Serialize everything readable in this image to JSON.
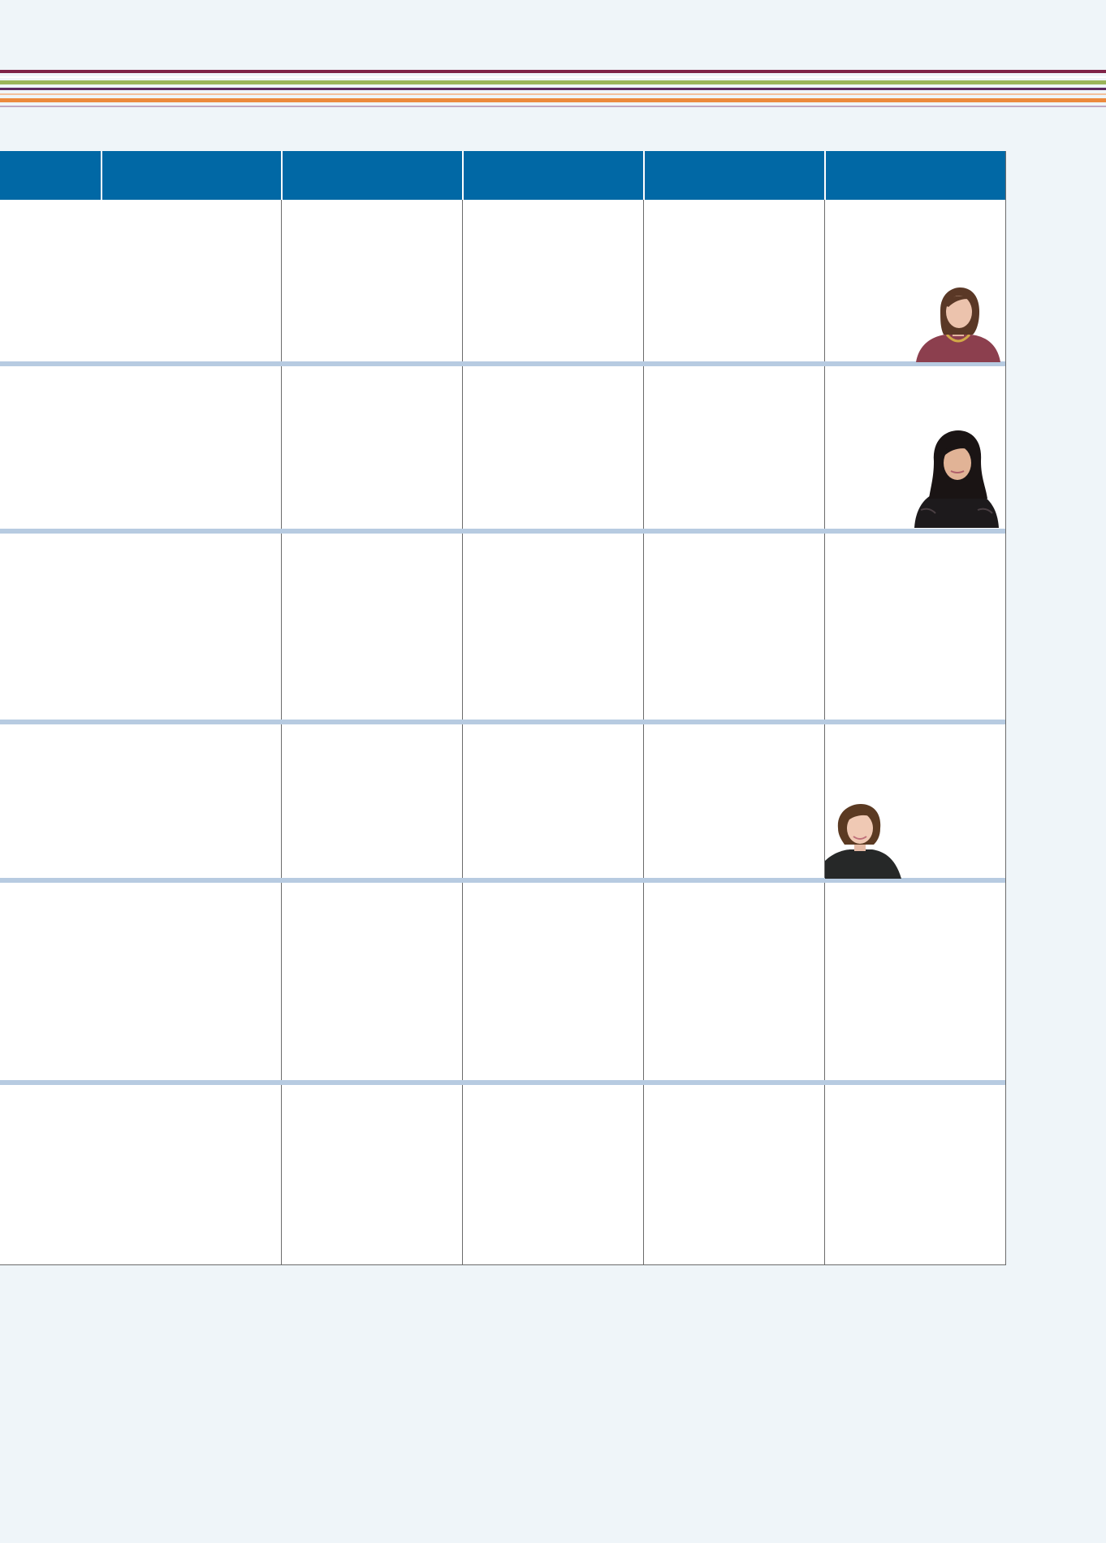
{
  "decor": {
    "stripe_colors": [
      "#7f2448",
      "#9ab55a",
      "#5e2a62",
      "#ec8a3d",
      "#c1a7c3"
    ]
  },
  "table": {
    "header_color": "#0168a5",
    "separator_color": "#b7cbe1",
    "columns": [
      "",
      "",
      "",
      "",
      "",
      ""
    ],
    "rows": 6
  },
  "photos": [
    {
      "name": "woman-portrait-1",
      "row": 1
    },
    {
      "name": "woman-portrait-2",
      "row": 2
    },
    {
      "name": "woman-portrait-3",
      "row": 4
    }
  ]
}
